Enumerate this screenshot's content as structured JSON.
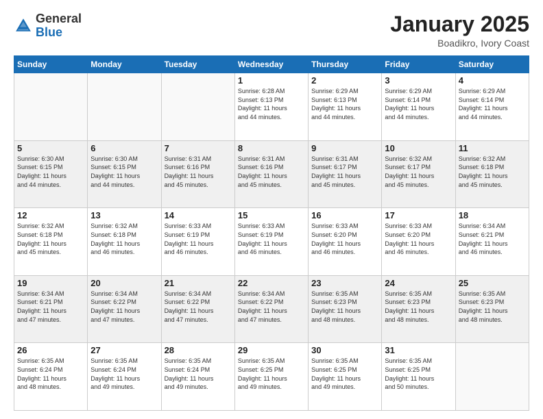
{
  "header": {
    "logo": {
      "general": "General",
      "blue": "Blue"
    },
    "title": "January 2025",
    "location": "Boadikro, Ivory Coast"
  },
  "weekdays": [
    "Sunday",
    "Monday",
    "Tuesday",
    "Wednesday",
    "Thursday",
    "Friday",
    "Saturday"
  ],
  "weeks": [
    [
      {
        "day": "",
        "info": ""
      },
      {
        "day": "",
        "info": ""
      },
      {
        "day": "",
        "info": ""
      },
      {
        "day": "1",
        "info": "Sunrise: 6:28 AM\nSunset: 6:13 PM\nDaylight: 11 hours\nand 44 minutes."
      },
      {
        "day": "2",
        "info": "Sunrise: 6:29 AM\nSunset: 6:13 PM\nDaylight: 11 hours\nand 44 minutes."
      },
      {
        "day": "3",
        "info": "Sunrise: 6:29 AM\nSunset: 6:14 PM\nDaylight: 11 hours\nand 44 minutes."
      },
      {
        "day": "4",
        "info": "Sunrise: 6:29 AM\nSunset: 6:14 PM\nDaylight: 11 hours\nand 44 minutes."
      }
    ],
    [
      {
        "day": "5",
        "info": "Sunrise: 6:30 AM\nSunset: 6:15 PM\nDaylight: 11 hours\nand 44 minutes."
      },
      {
        "day": "6",
        "info": "Sunrise: 6:30 AM\nSunset: 6:15 PM\nDaylight: 11 hours\nand 44 minutes."
      },
      {
        "day": "7",
        "info": "Sunrise: 6:31 AM\nSunset: 6:16 PM\nDaylight: 11 hours\nand 45 minutes."
      },
      {
        "day": "8",
        "info": "Sunrise: 6:31 AM\nSunset: 6:16 PM\nDaylight: 11 hours\nand 45 minutes."
      },
      {
        "day": "9",
        "info": "Sunrise: 6:31 AM\nSunset: 6:17 PM\nDaylight: 11 hours\nand 45 minutes."
      },
      {
        "day": "10",
        "info": "Sunrise: 6:32 AM\nSunset: 6:17 PM\nDaylight: 11 hours\nand 45 minutes."
      },
      {
        "day": "11",
        "info": "Sunrise: 6:32 AM\nSunset: 6:18 PM\nDaylight: 11 hours\nand 45 minutes."
      }
    ],
    [
      {
        "day": "12",
        "info": "Sunrise: 6:32 AM\nSunset: 6:18 PM\nDaylight: 11 hours\nand 45 minutes."
      },
      {
        "day": "13",
        "info": "Sunrise: 6:32 AM\nSunset: 6:18 PM\nDaylight: 11 hours\nand 46 minutes."
      },
      {
        "day": "14",
        "info": "Sunrise: 6:33 AM\nSunset: 6:19 PM\nDaylight: 11 hours\nand 46 minutes."
      },
      {
        "day": "15",
        "info": "Sunrise: 6:33 AM\nSunset: 6:19 PM\nDaylight: 11 hours\nand 46 minutes."
      },
      {
        "day": "16",
        "info": "Sunrise: 6:33 AM\nSunset: 6:20 PM\nDaylight: 11 hours\nand 46 minutes."
      },
      {
        "day": "17",
        "info": "Sunrise: 6:33 AM\nSunset: 6:20 PM\nDaylight: 11 hours\nand 46 minutes."
      },
      {
        "day": "18",
        "info": "Sunrise: 6:34 AM\nSunset: 6:21 PM\nDaylight: 11 hours\nand 46 minutes."
      }
    ],
    [
      {
        "day": "19",
        "info": "Sunrise: 6:34 AM\nSunset: 6:21 PM\nDaylight: 11 hours\nand 47 minutes."
      },
      {
        "day": "20",
        "info": "Sunrise: 6:34 AM\nSunset: 6:22 PM\nDaylight: 11 hours\nand 47 minutes."
      },
      {
        "day": "21",
        "info": "Sunrise: 6:34 AM\nSunset: 6:22 PM\nDaylight: 11 hours\nand 47 minutes."
      },
      {
        "day": "22",
        "info": "Sunrise: 6:34 AM\nSunset: 6:22 PM\nDaylight: 11 hours\nand 47 minutes."
      },
      {
        "day": "23",
        "info": "Sunrise: 6:35 AM\nSunset: 6:23 PM\nDaylight: 11 hours\nand 48 minutes."
      },
      {
        "day": "24",
        "info": "Sunrise: 6:35 AM\nSunset: 6:23 PM\nDaylight: 11 hours\nand 48 minutes."
      },
      {
        "day": "25",
        "info": "Sunrise: 6:35 AM\nSunset: 6:23 PM\nDaylight: 11 hours\nand 48 minutes."
      }
    ],
    [
      {
        "day": "26",
        "info": "Sunrise: 6:35 AM\nSunset: 6:24 PM\nDaylight: 11 hours\nand 48 minutes."
      },
      {
        "day": "27",
        "info": "Sunrise: 6:35 AM\nSunset: 6:24 PM\nDaylight: 11 hours\nand 49 minutes."
      },
      {
        "day": "28",
        "info": "Sunrise: 6:35 AM\nSunset: 6:24 PM\nDaylight: 11 hours\nand 49 minutes."
      },
      {
        "day": "29",
        "info": "Sunrise: 6:35 AM\nSunset: 6:25 PM\nDaylight: 11 hours\nand 49 minutes."
      },
      {
        "day": "30",
        "info": "Sunrise: 6:35 AM\nSunset: 6:25 PM\nDaylight: 11 hours\nand 49 minutes."
      },
      {
        "day": "31",
        "info": "Sunrise: 6:35 AM\nSunset: 6:25 PM\nDaylight: 11 hours\nand 50 minutes."
      },
      {
        "day": "",
        "info": ""
      }
    ]
  ]
}
